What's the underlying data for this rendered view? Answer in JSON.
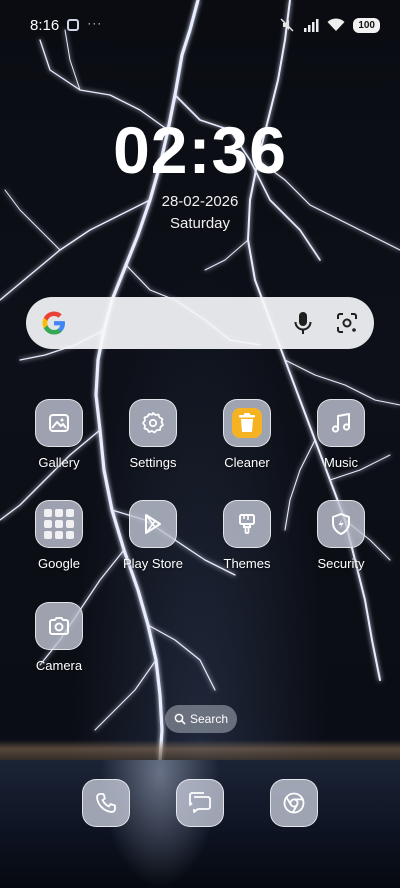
{
  "status_bar": {
    "time": "8:16",
    "battery": "100",
    "icons": [
      "notification-icon",
      "more-dots-icon",
      "mute-icon",
      "signal-icon",
      "wifi-icon",
      "battery-icon"
    ]
  },
  "clock": {
    "time": "02:36",
    "date": "28-02-2026",
    "weekday": "Saturday"
  },
  "search_bar": {
    "icons": [
      "google-g-icon",
      "microphone-icon",
      "google-lens-icon"
    ]
  },
  "apps": [
    {
      "label": "Gallery",
      "icon": "gallery-icon"
    },
    {
      "label": "Settings",
      "icon": "gear-icon"
    },
    {
      "label": "Cleaner",
      "icon": "trash-icon"
    },
    {
      "label": "Music",
      "icon": "music-note-icon"
    },
    {
      "label": "Google",
      "icon": "google-folder-icon"
    },
    {
      "label": "Play Store",
      "icon": "play-store-icon"
    },
    {
      "label": "Themes",
      "icon": "brush-icon"
    },
    {
      "label": "Security",
      "icon": "shield-bolt-icon"
    },
    {
      "label": "Camera",
      "icon": "camera-icon"
    }
  ],
  "search_pill": {
    "label": "Search"
  },
  "dock": [
    {
      "icon": "phone-icon"
    },
    {
      "icon": "messages-icon"
    },
    {
      "icon": "chrome-icon"
    }
  ],
  "colors": {
    "cleaner_accent": "#f5b323",
    "icon_tile": "#bec3d2",
    "background": "#07080c"
  }
}
